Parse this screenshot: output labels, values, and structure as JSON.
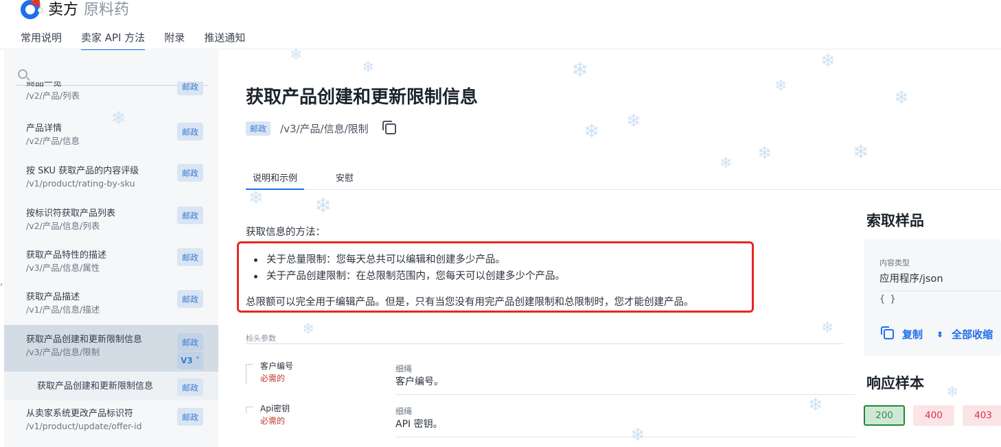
{
  "brand": {
    "name": "卖方",
    "sub": "原料药"
  },
  "nav": [
    {
      "label": "常用说明"
    },
    {
      "label": "卖家 API 方法",
      "active": true
    },
    {
      "label": "附录"
    },
    {
      "label": "推送通知"
    }
  ],
  "sidebar": {
    "items": [
      {
        "title": "商品一览",
        "path": "/v2/产品/列表",
        "badge": "邮政"
      },
      {
        "title": "产品详情",
        "path": "/v2/产品/信息",
        "badge": "邮政"
      },
      {
        "title": "按 SKU 获取产品的内容评级",
        "path": "/v1/product/rating-by-sku",
        "badge": "邮政"
      },
      {
        "title": "按标识符获取产品列表",
        "path": "/v2/产品/信息/列表",
        "badge": "邮政"
      },
      {
        "title": "获取产品特性的描述",
        "path": "/v3/产品/信息/属性",
        "badge": "邮政"
      },
      {
        "title": "获取产品描述",
        "path": "/v1/产品/信息/描述",
        "badge": "邮政"
      },
      {
        "title": "获取产品创建和更新限制信息",
        "path": "/v3/产品/信息/限制",
        "badge": "邮政",
        "version": "V3 ˅"
      },
      {
        "title": "获取产品创建和更新限制信息",
        "badge": "邮政"
      },
      {
        "title": "从卖家系统更改产品标识符",
        "path": "/v1/product/update/offer-id",
        "badge": "邮政"
      }
    ]
  },
  "main": {
    "title": "获取产品创建和更新限制信息",
    "method": "邮政",
    "path": "/v3/产品/信息/限制",
    "tabs": [
      {
        "label": "说明和示例"
      },
      {
        "label": "安慰"
      }
    ],
    "intro": "获取信息的方法：",
    "bullets": [
      "关于总量限制：您每天总共可以编辑和创建多少产品。",
      "关于产品创建限制：在总限制范围内，您每天可以创建多少个产品。"
    ],
    "total_note": "总限额可以完全用于编辑产品。但是，只有当您没有用完产品创建限制和总限制时，您才能创建产品。",
    "header_params_label": "标头参数",
    "params": [
      {
        "name": "客户编号",
        "required": "必需的",
        "type": "细绳",
        "desc": "客户编号。"
      },
      {
        "name": "Api密钥",
        "required": "必需的",
        "type": "细绳",
        "desc": "API 密钥。"
      }
    ]
  },
  "right": {
    "request_title": "索取样品",
    "content_type_label": "内容类型",
    "content_type": "应用程序/json",
    "body": "{ }",
    "copy": "复制",
    "collapse": "全部收缩",
    "response_title": "响应样本",
    "codes": [
      "200",
      "400",
      "403"
    ]
  },
  "colors": {
    "accent": "#1f6feb",
    "highlight_border": "#e8261f",
    "ok_border": "#1d8a32"
  }
}
